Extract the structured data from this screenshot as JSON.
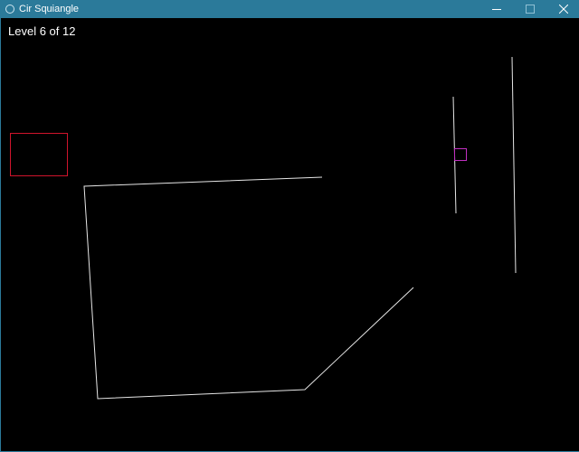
{
  "window": {
    "title": "Cir Squiangle",
    "controls": [
      "minimize",
      "maximize",
      "close"
    ]
  },
  "hud": {
    "level_text": "Level 6 of 12"
  },
  "colors": {
    "titlebar": "#2b7a9a",
    "background": "#000000",
    "wall": "#e6e6e6",
    "goal": "#d0142c",
    "player": "#c030c0"
  },
  "icons": {
    "app": "circle-outline-icon",
    "minimize": "minimize-icon",
    "maximize": "maximize-icon",
    "close": "close-icon"
  }
}
